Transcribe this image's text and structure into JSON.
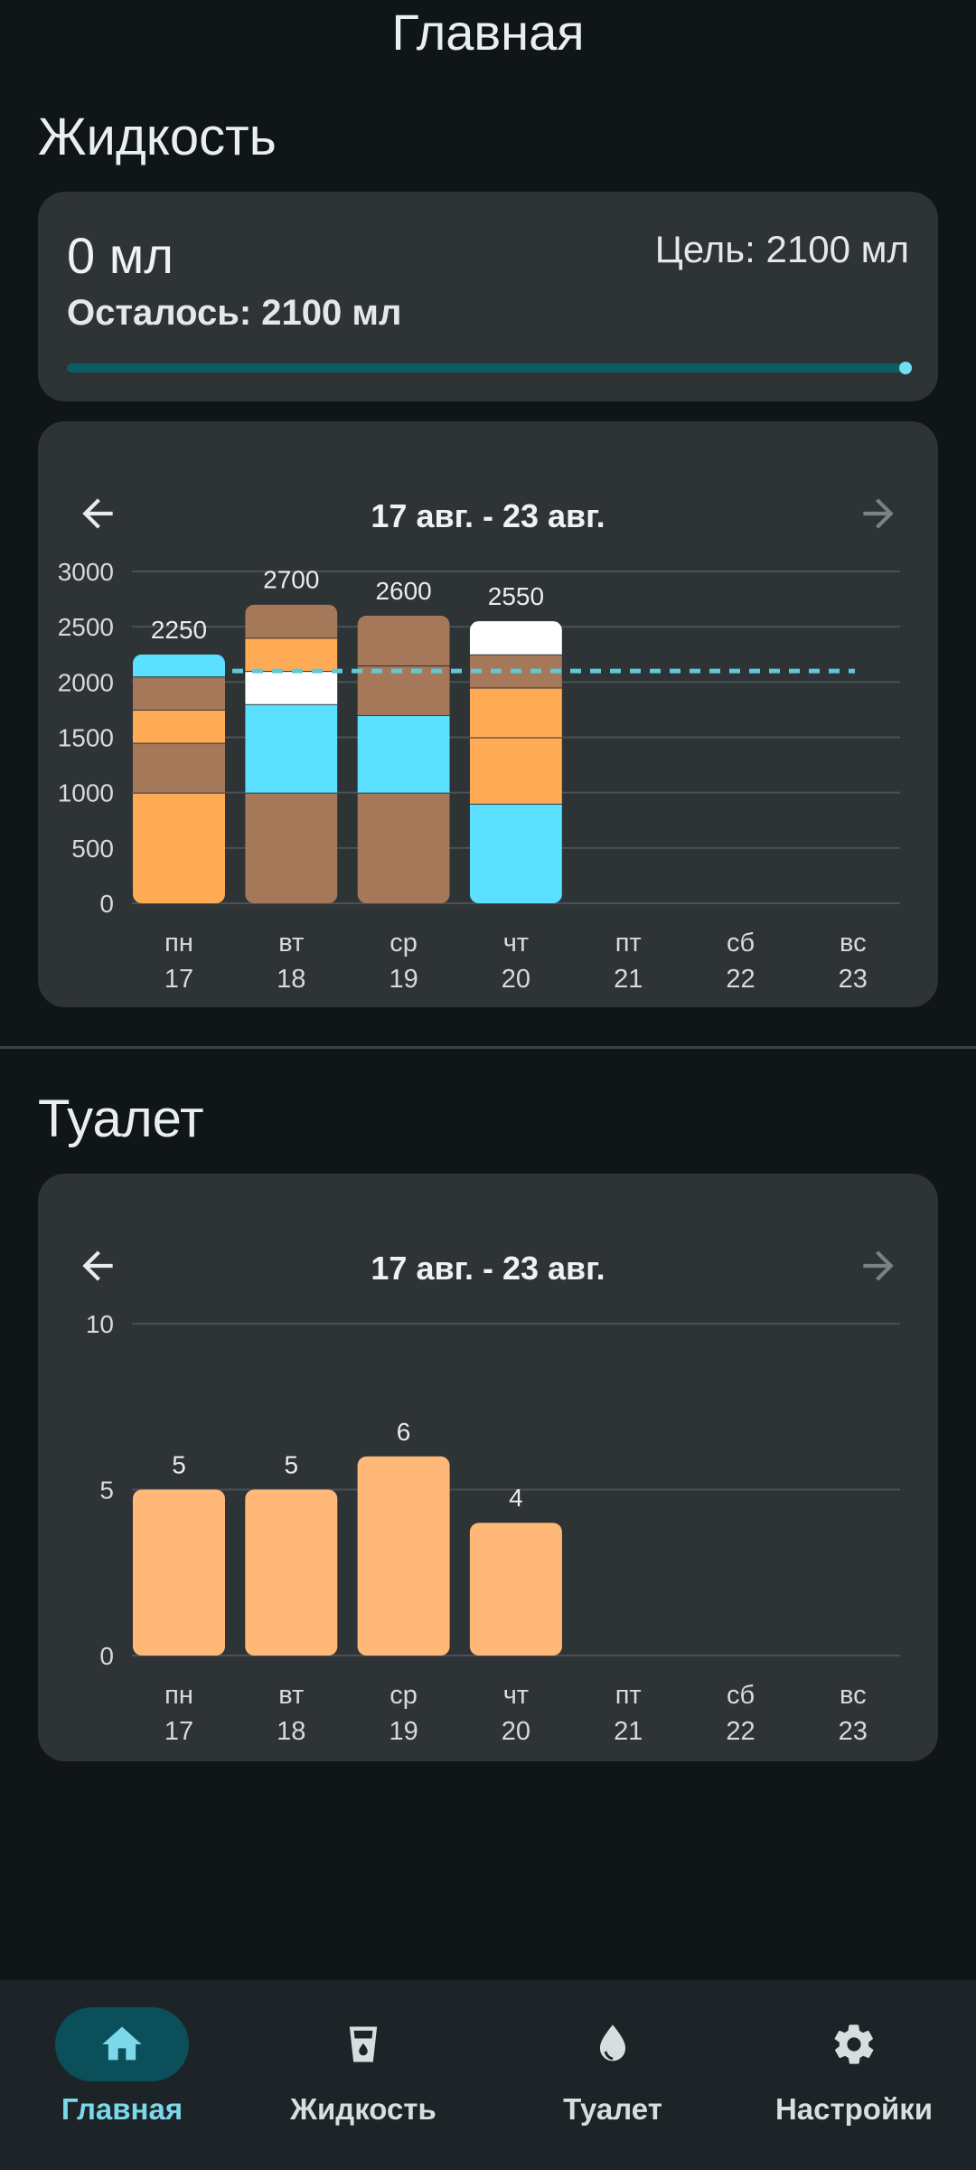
{
  "header": {
    "title": "Главная"
  },
  "fluid": {
    "section_title": "Жидкость",
    "summary": {
      "amount": "0 мл",
      "goal": "Цель: 2100 мл",
      "remaining": "Осталось: 2100 мл",
      "progress": 0
    },
    "week": {
      "range": "17 авг. - 23 авг.",
      "prev_icon": "arrow-left-icon",
      "next_icon": "arrow-right-icon"
    }
  },
  "toilet": {
    "section_title": "Туалет",
    "week": {
      "range": "17 авг. - 23 авг.",
      "prev_icon": "arrow-left-icon",
      "next_icon": "arrow-right-icon"
    }
  },
  "chart_data": [
    {
      "type": "bar",
      "stacked": true,
      "categories": [
        "пн 17",
        "вт 18",
        "ср 19",
        "чт 20",
        "пт 21",
        "сб 22",
        "вс 23"
      ],
      "day_labels": [
        "пн",
        "вт",
        "ср",
        "чт",
        "пт",
        "сб",
        "вс"
      ],
      "date_labels": [
        "17",
        "18",
        "19",
        "20",
        "21",
        "22",
        "23"
      ],
      "y_ticks": [
        "0",
        "500",
        "1000",
        "1500",
        "2000",
        "2500",
        "3000"
      ],
      "ylim": [
        0,
        3000
      ],
      "totals": [
        2250,
        2700,
        2600,
        2550,
        null,
        null,
        null
      ],
      "total_labels": [
        "2250",
        "2700",
        "2600",
        "2550",
        "",
        "",
        ""
      ],
      "goal_line": 2100,
      "goal_line_color": "#5fc9d8",
      "stacks": [
        [
          {
            "value": 1000,
            "color": "#ffaa55"
          },
          {
            "value": 450,
            "color": "#a6785a"
          },
          {
            "value": 300,
            "color": "#ffaa55"
          },
          {
            "value": 300,
            "color": "#a6785a"
          },
          {
            "value": 200,
            "color": "#5be0ff"
          }
        ],
        [
          {
            "value": 1000,
            "color": "#a6785a"
          },
          {
            "value": 800,
            "color": "#5be0ff"
          },
          {
            "value": 300,
            "color": "#ffffff"
          },
          {
            "value": 300,
            "color": "#ffaa55"
          },
          {
            "value": 300,
            "color": "#a6785a"
          }
        ],
        [
          {
            "value": 1000,
            "color": "#a6785a"
          },
          {
            "value": 700,
            "color": "#5be0ff"
          },
          {
            "value": 450,
            "color": "#a6785a"
          },
          {
            "value": 450,
            "color": "#a6785a"
          }
        ],
        [
          {
            "value": 900,
            "color": "#5be0ff"
          },
          {
            "value": 600,
            "color": "#ffaa55"
          },
          {
            "value": 450,
            "color": "#ffaa55"
          },
          {
            "value": 300,
            "color": "#a6785a"
          },
          {
            "value": 300,
            "color": "#ffffff"
          }
        ],
        [],
        [],
        []
      ],
      "grid": true
    },
    {
      "type": "bar",
      "categories": [
        "пн 17",
        "вт 18",
        "ср 19",
        "чт 20",
        "пт 21",
        "сб 22",
        "вс 23"
      ],
      "day_labels": [
        "пн",
        "вт",
        "ср",
        "чт",
        "пт",
        "сб",
        "вс"
      ],
      "date_labels": [
        "17",
        "18",
        "19",
        "20",
        "21",
        "22",
        "23"
      ],
      "y_ticks": [
        "0",
        "5",
        "10"
      ],
      "ylim": [
        0,
        10
      ],
      "values": [
        5,
        5,
        6,
        4,
        null,
        null,
        null
      ],
      "value_labels": [
        "5",
        "5",
        "6",
        "4",
        "",
        "",
        ""
      ],
      "bar_color": "#ffb877",
      "grid": true
    }
  ],
  "bottom_nav": {
    "items": [
      {
        "label": "Главная",
        "icon": "home-icon",
        "active": true
      },
      {
        "label": "Жидкость",
        "icon": "glass-icon",
        "active": false
      },
      {
        "label": "Туалет",
        "icon": "drop-icon",
        "active": false
      },
      {
        "label": "Настройки",
        "icon": "gear-icon",
        "active": false
      }
    ]
  },
  "colors": {
    "background": "#101518",
    "card": "#2e3336",
    "accent": "#7ad8ea",
    "progress_track": "#0c5c63"
  }
}
